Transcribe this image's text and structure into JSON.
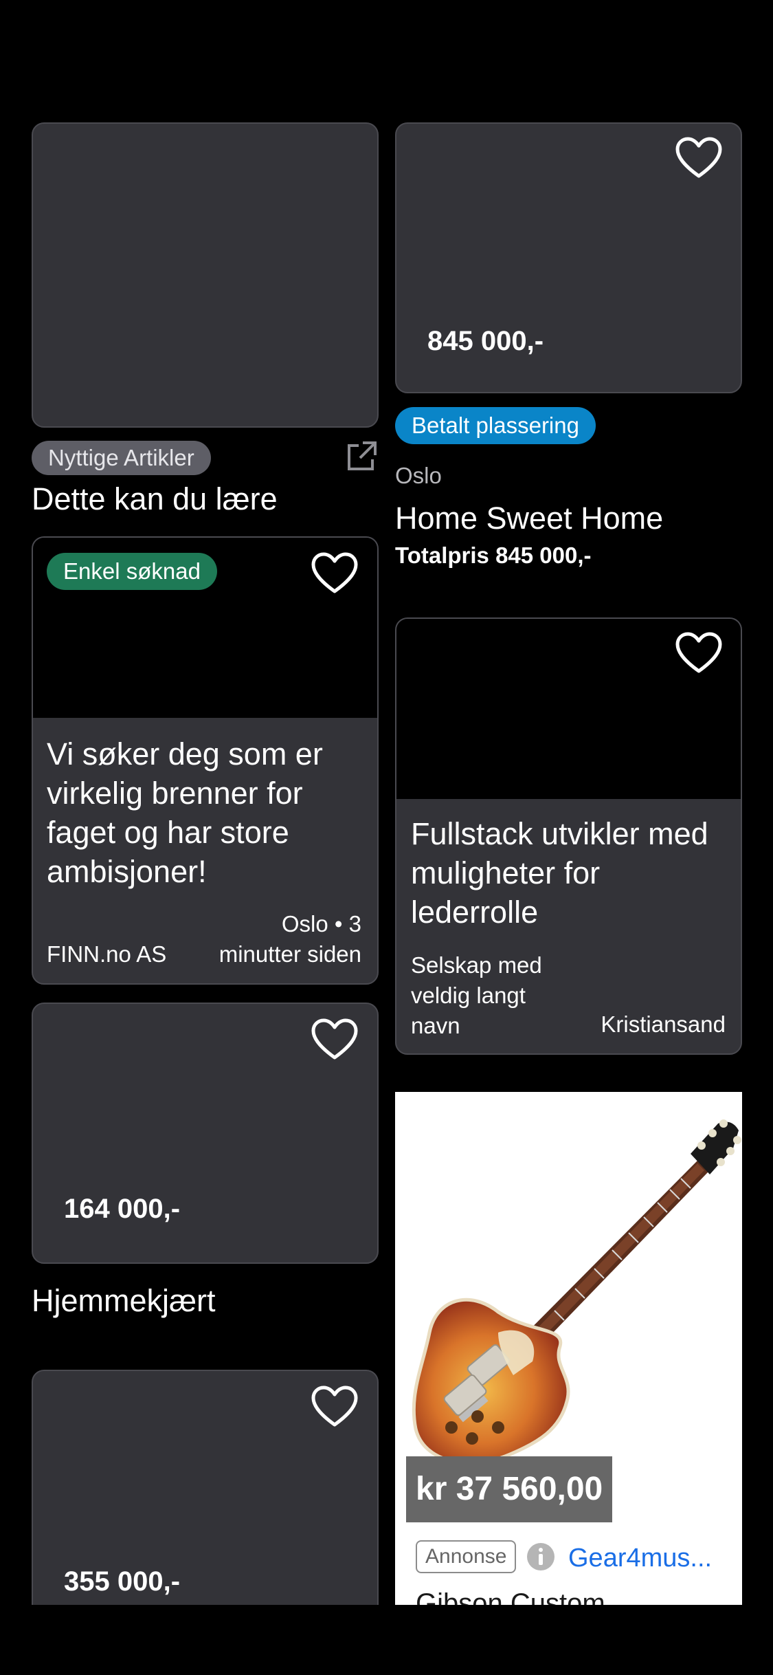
{
  "colors": {
    "background": "#000000",
    "card": "#333338",
    "paid_badge": "#0a85c8",
    "easy_apply_badge": "#1e7a56",
    "article_badge": "#5e5e66",
    "price_label_bg": "#676767",
    "link_blue": "#1a6ee6"
  },
  "icons": [
    "heart-icon",
    "external-link-icon",
    "info-icon"
  ],
  "cards": {
    "article": {
      "badge": "Nyttige Artikler",
      "title": "Dette kan du lære"
    },
    "home": {
      "price_overlay": "845 000,-",
      "badge": "Betalt plassering",
      "location": "Oslo",
      "title": "Home Sweet Home",
      "total_price": "Totalpris 845 000,-"
    },
    "job1": {
      "badge": "Enkel søknad",
      "title_lines": [
        "Vi søker deg som er",
        "virkelig brenner for",
        "faget og har store",
        "ambisjoner!"
      ],
      "company": "FINN.no AS",
      "meta_lines": [
        "Oslo • 3",
        "minutter siden"
      ]
    },
    "job2": {
      "title_lines": [
        "Fullstack utvikler med",
        "muligheter for",
        "lederrolle"
      ],
      "company_lines": [
        "Selskap med",
        "veldig langt",
        "navn"
      ],
      "location": "Kristiansand"
    },
    "item1": {
      "price_overlay": "164 000,-",
      "title": "Hjemmekjært"
    },
    "item2": {
      "price_overlay": "355 000,-"
    },
    "ad": {
      "price": "kr 37 560,00",
      "ad_label": "Annonse",
      "advertiser": "Gear4mus...",
      "title": "Gibson Custom"
    }
  }
}
